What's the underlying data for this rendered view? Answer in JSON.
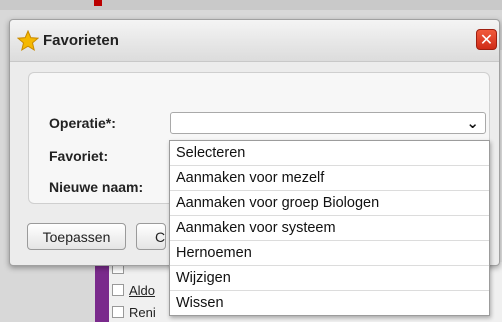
{
  "background": {
    "rows": [
      {
        "label": ""
      },
      {
        "label": "Aldo"
      },
      {
        "label": "Reni"
      }
    ]
  },
  "dialog": {
    "title": "Favorieten",
    "close_label": "✕",
    "fields": {
      "operatie_label": "Operatie*:",
      "operatie_value": "",
      "favoriet_label": "Favoriet:",
      "nieuwe_naam_label": "Nieuwe naam:"
    },
    "buttons": {
      "apply": "Toepassen",
      "second_partial": "C"
    }
  },
  "dropdown": {
    "options": [
      "Selecteren",
      "Aanmaken voor mezelf",
      "Aanmaken voor groep Biologen",
      "Aanmaken voor systeem",
      "Hernoemen",
      "Wijzigen",
      "Wissen"
    ]
  },
  "colors": {
    "close_red": "#e0402a",
    "star_yellow": "#f5b800",
    "sidebar_purple": "#7a2a8c"
  },
  "icons": {
    "title": "star-icon",
    "close": "close-icon",
    "select": "chevron-down-icon"
  }
}
